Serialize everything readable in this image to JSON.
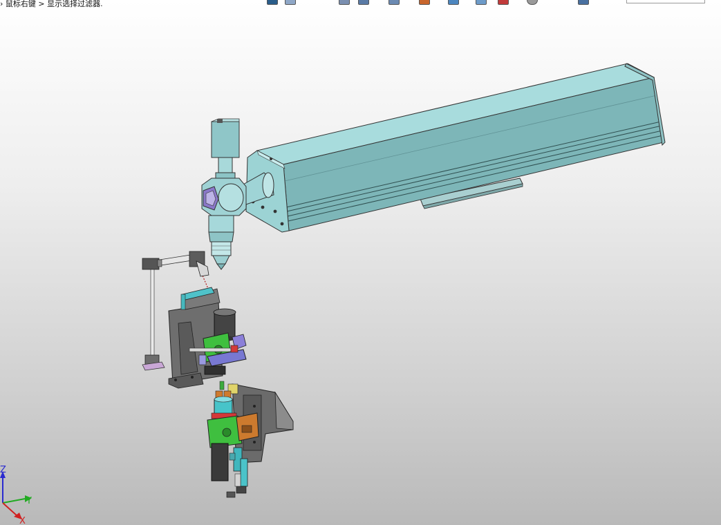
{
  "status_hint": "› 鼠标右键 > 显示选择过滤器.",
  "toolbar": {
    "icons": [
      {
        "name": "view-icon",
        "color": "#2a5d8a"
      },
      {
        "name": "pencil-icon",
        "color": "#8fa7c7"
      },
      {
        "name": "rotate-icon",
        "color": "#7a8fb0"
      },
      {
        "name": "cube-icon",
        "color": "#5a7aa5"
      },
      {
        "name": "section-icon",
        "color": "#6b8ab2"
      },
      {
        "name": "appearance-icon",
        "color": "#c8652c"
      },
      {
        "name": "scene-icon",
        "color": "#4c86bf"
      },
      {
        "name": "display-icon",
        "color": "#6d9bc9"
      },
      {
        "name": "render-icon",
        "color": "#c23b3b"
      },
      {
        "name": "sphere-icon",
        "color": "#9a9a9a"
      },
      {
        "name": "window-icon",
        "color": "#4970a0"
      }
    ],
    "search_value": ""
  },
  "triad": {
    "x": "X",
    "y": "Y",
    "z": "Z"
  },
  "colors": {
    "beam": "#8fc7c7",
    "beam_dark": "#6aa3a6",
    "fixture_gray": "#6b6b6b",
    "fixture_green": "#3fbf3f",
    "fixture_blue": "#7b7bd6",
    "fixture_cyan": "#47c7c7",
    "fixture_orange": "#cc7a2e"
  }
}
